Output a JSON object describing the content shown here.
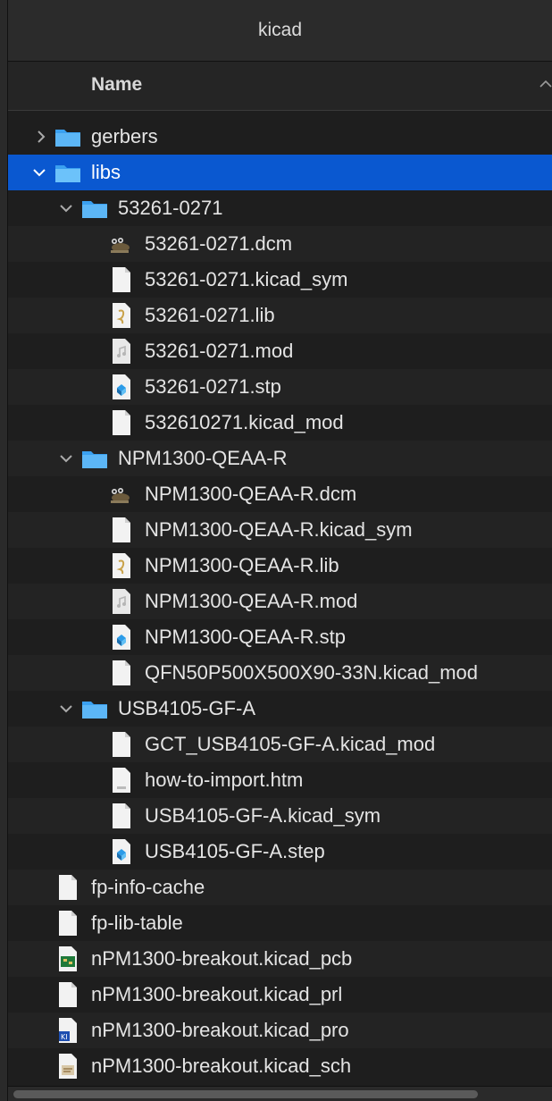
{
  "window": {
    "title": "kicad"
  },
  "header": {
    "name_label": "Name"
  },
  "rows": [
    {
      "label": "gerbers"
    },
    {
      "label": "libs"
    },
    {
      "label": "53261-0271"
    },
    {
      "label": "53261-0271.dcm"
    },
    {
      "label": "53261-0271.kicad_sym"
    },
    {
      "label": "53261-0271.lib"
    },
    {
      "label": "53261-0271.mod"
    },
    {
      "label": "53261-0271.stp"
    },
    {
      "label": "532610271.kicad_mod"
    },
    {
      "label": "NPM1300-QEAA-R"
    },
    {
      "label": "NPM1300-QEAA-R.dcm"
    },
    {
      "label": "NPM1300-QEAA-R.kicad_sym"
    },
    {
      "label": "NPM1300-QEAA-R.lib"
    },
    {
      "label": "NPM1300-QEAA-R.mod"
    },
    {
      "label": "NPM1300-QEAA-R.stp"
    },
    {
      "label": "QFN50P500X500X90-33N.kicad_mod"
    },
    {
      "label": "USB4105-GF-A"
    },
    {
      "label": "GCT_USB4105-GF-A.kicad_mod"
    },
    {
      "label": "how-to-import.htm"
    },
    {
      "label": "USB4105-GF-A.kicad_sym"
    },
    {
      "label": "USB4105-GF-A.step"
    },
    {
      "label": "fp-info-cache"
    },
    {
      "label": "fp-lib-table"
    },
    {
      "label": "nPM1300-breakout.kicad_pcb"
    },
    {
      "label": "nPM1300-breakout.kicad_prl"
    },
    {
      "label": "nPM1300-breakout.kicad_pro"
    },
    {
      "label": "nPM1300-breakout.kicad_sch"
    }
  ],
  "colors": {
    "selection": "#0a58d0",
    "folder": "#3aa0f0"
  },
  "icons": {
    "folder": "folder-icon",
    "dcm": "gimp-icon",
    "doc": "document-icon",
    "lib": "lib-icon",
    "mod": "audio-file-icon",
    "stp": "stp-icon",
    "htm": "htm-file-icon",
    "pcb": "pcb-icon",
    "pro": "kicad-project-icon",
    "sch": "schematic-icon"
  }
}
